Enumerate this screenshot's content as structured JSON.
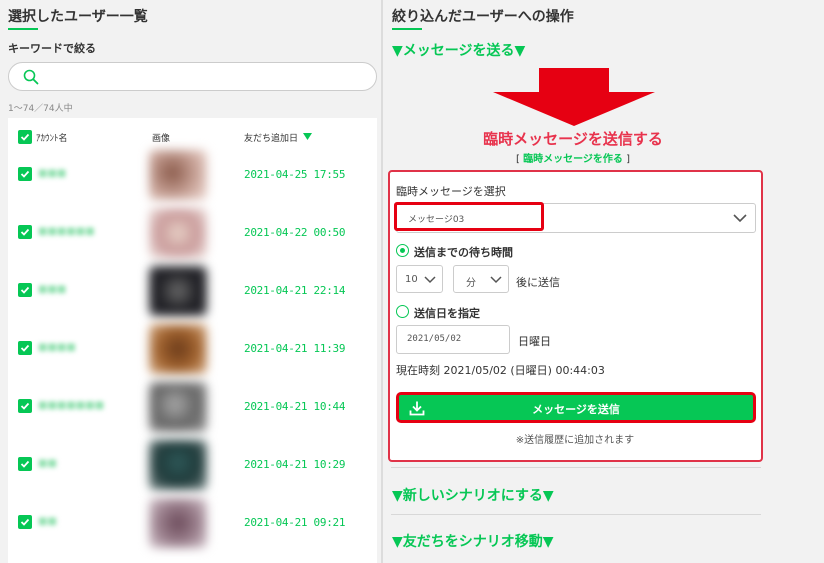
{
  "left": {
    "title": "選択したユーザー一覧",
    "keyword_label": "キーワードで絞る",
    "search": {
      "placeholder": "",
      "value": ""
    },
    "range_text": "1〜74／74人中",
    "columns": {
      "name": "ｱｶｳﾝﾄ名",
      "image": "画像",
      "date": "友だち追加日"
    },
    "rows": [
      {
        "name": "■■■",
        "date": "2021-04-25 17:55"
      },
      {
        "name": "■■■■■■",
        "date": "2021-04-22 00:50"
      },
      {
        "name": "■■■",
        "date": "2021-04-21 22:14"
      },
      {
        "name": "■■■■",
        "date": "2021-04-21 11:39"
      },
      {
        "name": "■■■■■■■",
        "date": "2021-04-21 10:44"
      },
      {
        "name": "■■",
        "date": "2021-04-21 10:29"
      },
      {
        "name": "■■",
        "date": "2021-04-21 09:21"
      }
    ]
  },
  "right": {
    "title": "絞り込んだユーザーへの操作",
    "send_message_toggle": "▼メッセージを送る▼",
    "temp_title": "臨時メッセージを送信する",
    "temp_link_open": "[ ",
    "temp_link": "臨時メッセージを作る",
    "temp_link_close": " ]",
    "select_label": "臨時メッセージを選択",
    "select_value": "メッセージ03",
    "wait_label": "送信までの待ち時間",
    "wait_value": "10",
    "wait_unit": "分",
    "after_text": "後に送信",
    "date_label": "送信日を指定",
    "date_value": "2021/05/02",
    "weekday": "日曜日",
    "now_text": "現在時刻 2021/05/02 (日曜日) 00:44:03",
    "send_button": "メッセージを送信",
    "send_note": "※送信履歴に追加されます",
    "scenario_new": "▼新しいシナリオにする▼",
    "scenario_move": "▼友だちをシナリオ移動▼"
  },
  "colors": {
    "accent": "#06c755",
    "alert": "#e60012",
    "title_red": "#e8334d"
  }
}
